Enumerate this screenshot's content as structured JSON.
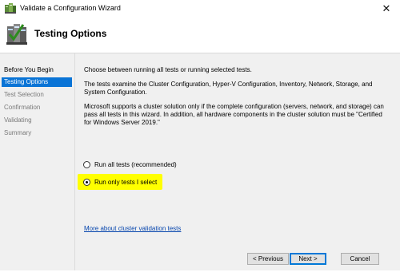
{
  "window": {
    "title": "Validate a Configuration Wizard",
    "close_glyph": "✕",
    "icon": "cluster-wizard-icon"
  },
  "header": {
    "title": "Testing Options",
    "icon": "testing-options-icon"
  },
  "sidebar": {
    "items": [
      {
        "label": "Before You Begin",
        "state": "done"
      },
      {
        "label": "Testing Options",
        "state": "active"
      },
      {
        "label": "Test Selection",
        "state": "pending"
      },
      {
        "label": "Confirmation",
        "state": "pending"
      },
      {
        "label": "Validating",
        "state": "pending"
      },
      {
        "label": "Summary",
        "state": "pending"
      }
    ]
  },
  "main": {
    "intro": "Choose between running all tests or running selected tests.",
    "para2": "The tests examine the Cluster Configuration, Hyper-V Configuration, Inventory, Network, Storage, and System Configuration.",
    "para3": "Microsoft supports a cluster solution only if the complete configuration (servers, network, and storage) can pass all tests in this wizard. In addition, all hardware components in the cluster solution must be \"Certified for Windows Server 2019.\"",
    "options": [
      {
        "label": "Run all tests (recommended)",
        "checked": false
      },
      {
        "label": "Run only tests I select",
        "checked": true
      }
    ],
    "link": "More about cluster validation tests"
  },
  "buttons": {
    "previous": "< Previous",
    "next": "Next >",
    "cancel": "Cancel"
  },
  "colors": {
    "active_item": "#0a74d6",
    "highlight": "#ffff00",
    "link": "#0645ad"
  }
}
